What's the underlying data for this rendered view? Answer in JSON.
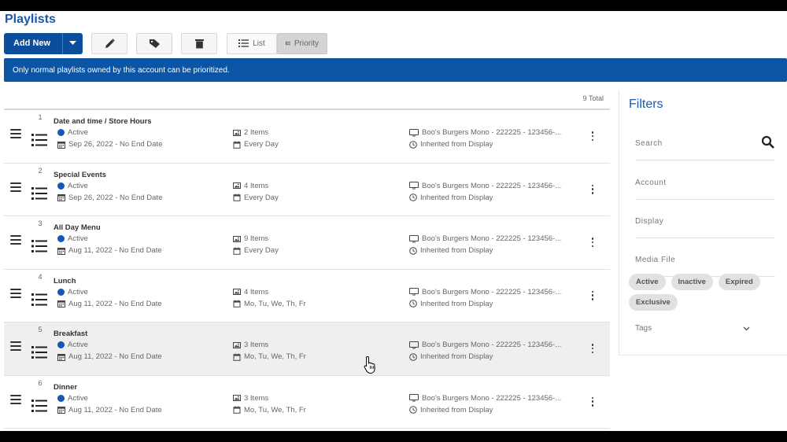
{
  "page": {
    "title": "Playlists"
  },
  "toolbar": {
    "add_new_label": "Add New",
    "list_label": "List",
    "priority_label": "Priority"
  },
  "info_message": "Only normal playlists owned by this account can be prioritized.",
  "list": {
    "total_text": "9 Total",
    "rows": [
      {
        "num": "1",
        "name": "Date and time / Store Hours",
        "status": "Active",
        "date": "Sep 26, 2022 - No End Date",
        "items": "2 Items",
        "schedule": "Every Day",
        "display": "Boo's Burgers Mono - 222225 - 123456-...",
        "inherit": "Inherited from Display"
      },
      {
        "num": "2",
        "name": "Special Events",
        "status": "Active",
        "date": "Sep 26, 2022 - No End Date",
        "items": "4 Items",
        "schedule": "Every Day",
        "display": "Boo's Burgers Mono - 222225 - 123456-...",
        "inherit": "Inherited from Display"
      },
      {
        "num": "3",
        "name": "All Day Menu",
        "status": "Active",
        "date": "Aug 11, 2022 - No End Date",
        "items": "9 Items",
        "schedule": "Every Day",
        "display": "Boo's Burgers Mono - 222225 - 123456-...",
        "inherit": "Inherited from Display"
      },
      {
        "num": "4",
        "name": "Lunch",
        "status": "Active",
        "date": "Aug 11, 2022 - No End Date",
        "items": "4 Items",
        "schedule": "Mo, Tu, We, Th, Fr",
        "display": "Boo's Burgers Mono - 222225 - 123456-...",
        "inherit": "Inherited from Display"
      },
      {
        "num": "5",
        "name": "Breakfast",
        "status": "Active",
        "date": "Aug 11, 2022 - No End Date",
        "items": "3 Items",
        "schedule": "Mo, Tu, We, Th, Fr",
        "display": "Boo's Burgers Mono - 222225 - 123456-...",
        "inherit": "Inherited from Display"
      },
      {
        "num": "6",
        "name": "Dinner",
        "status": "Active",
        "date": "Aug 11, 2022 - No End Date",
        "items": "3 Items",
        "schedule": "Mo, Tu, We, Th, Fr",
        "display": "Boo's Burgers Mono - 222225 - 123456-...",
        "inherit": "Inherited from Display"
      }
    ]
  },
  "filters": {
    "title": "Filters",
    "search_label": "Search",
    "account_label": "Account",
    "display_label": "Display",
    "media_file_label": "Media File",
    "chips": [
      "Active",
      "Inactive",
      "Expired",
      "Exclusive"
    ],
    "tags_label": "Tags"
  },
  "colors": {
    "brand": "#0b55a4",
    "status_active": "#1556b6"
  },
  "icons": [
    "pencil-icon",
    "tag-icon",
    "trash-icon",
    "list-icon",
    "priority-icon",
    "search-icon",
    "chevron-down-icon",
    "calendar-icon",
    "image-icon",
    "monitor-icon",
    "clock-icon"
  ]
}
